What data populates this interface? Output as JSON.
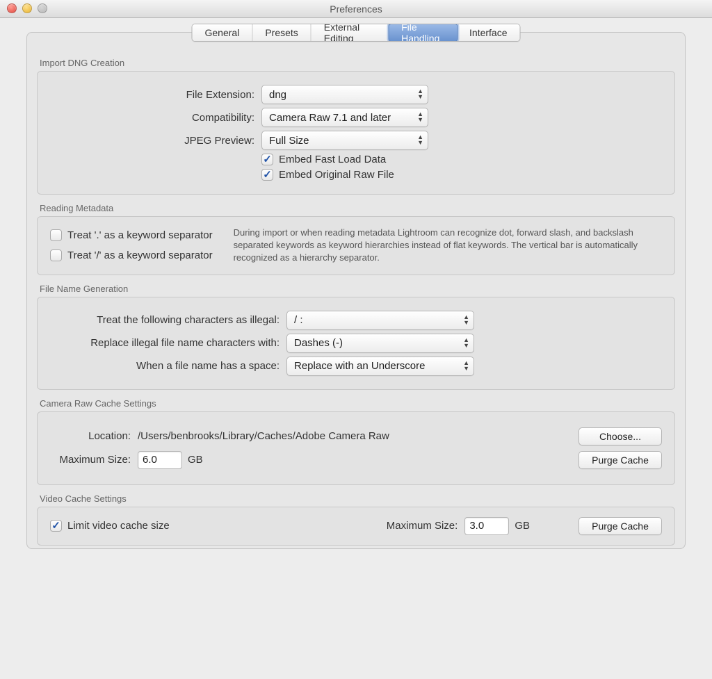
{
  "window": {
    "title": "Preferences"
  },
  "tabs": {
    "general": "General",
    "presets": "Presets",
    "external": "External Editing",
    "file_handling": "File Handling",
    "interface": "Interface"
  },
  "import_dng": {
    "heading": "Import DNG Creation",
    "file_extension_label": "File Extension:",
    "file_extension_value": "dng",
    "compatibility_label": "Compatibility:",
    "compatibility_value": "Camera Raw 7.1 and later",
    "jpeg_preview_label": "JPEG Preview:",
    "jpeg_preview_value": "Full Size",
    "embed_fast_label": "Embed Fast Load Data",
    "embed_original_label": "Embed Original Raw File"
  },
  "reading_metadata": {
    "heading": "Reading Metadata",
    "treat_dot": "Treat '.' as a keyword separator",
    "treat_slash": "Treat '/' as a keyword separator",
    "description": "During import or when reading metadata Lightroom can recognize dot, forward slash, and backslash separated keywords as keyword hierarchies instead of flat keywords. The vertical bar is automatically recognized as a hierarchy separator."
  },
  "filegen": {
    "heading": "File Name Generation",
    "illegal_label": "Treat the following characters as illegal:",
    "illegal_value": "/ :",
    "replace_label": "Replace illegal file name characters with:",
    "replace_value": "Dashes (-)",
    "space_label": "When a file name has a space:",
    "space_value": "Replace with an Underscore"
  },
  "camera_cache": {
    "heading": "Camera Raw Cache Settings",
    "location_label": "Location:",
    "location_value": "/Users/benbrooks/Library/Caches/Adobe Camera Raw",
    "choose": "Choose...",
    "max_label": "Maximum Size:",
    "max_value": "6.0",
    "unit": "GB",
    "purge": "Purge Cache"
  },
  "video_cache": {
    "heading": "Video Cache Settings",
    "limit_label": "Limit video cache size",
    "max_label": "Maximum Size:",
    "max_value": "3.0",
    "unit": "GB",
    "purge": "Purge Cache"
  }
}
